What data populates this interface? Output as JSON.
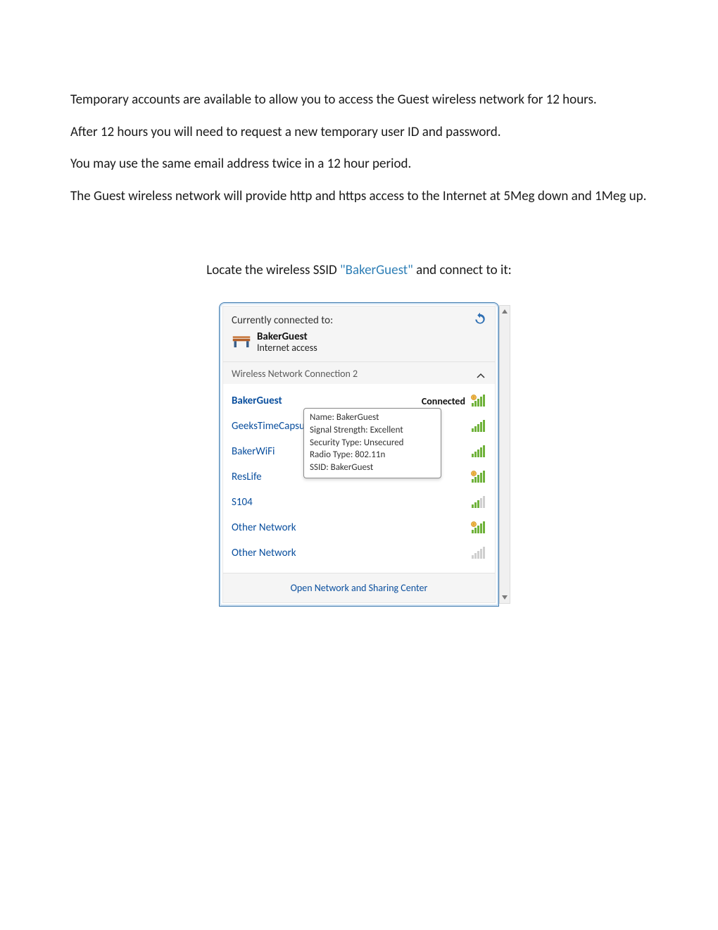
{
  "paragraphs": {
    "p1": "Temporary accounts are available to allow you to access the Guest wireless network for 12 hours.",
    "p2": "After 12 hours you will need to request a new temporary user ID and password.",
    "p3": "You may use the same email address twice in a 12 hour period.",
    "p4": "The Guest wireless network will provide http and https access to the Internet at 5Meg down and 1Meg up."
  },
  "instruction": {
    "pre": "Locate the wireless SSID ",
    "ssid": "\"BakerGuest\"",
    "post": " and connect to it:"
  },
  "flyout": {
    "header": {
      "title": "Currently connected to:",
      "connection_name": "BakerGuest",
      "connection_sub": "Internet access"
    },
    "adapter_label": "Wireless Network Connection 2",
    "networks": [
      {
        "name": "BakerGuest",
        "status": "Connected",
        "signal": "full",
        "shield": true,
        "bold": true
      },
      {
        "name": "GeeksTimeCapsule",
        "status": "",
        "signal": "full",
        "shield": false,
        "bold": false
      },
      {
        "name": "BakerWiFi",
        "status": "",
        "signal": "full",
        "shield": false,
        "bold": false
      },
      {
        "name": "ResLife",
        "status": "",
        "signal": "full",
        "shield": true,
        "bold": false
      },
      {
        "name": "S104",
        "status": "",
        "signal": "med",
        "shield": false,
        "bold": false
      },
      {
        "name": "Other Network",
        "status": "",
        "signal": "full",
        "shield": true,
        "bold": false
      },
      {
        "name": "Other Network",
        "status": "",
        "signal": "low",
        "shield": false,
        "bold": false
      }
    ],
    "tooltip": {
      "l1": "Name: BakerGuest",
      "l2": "Signal Strength: Excellent",
      "l3": "Security Type: Unsecured",
      "l4": "Radio Type: 802.11n",
      "l5": "SSID: BakerGuest"
    },
    "footer": "Open Network and Sharing Center"
  }
}
